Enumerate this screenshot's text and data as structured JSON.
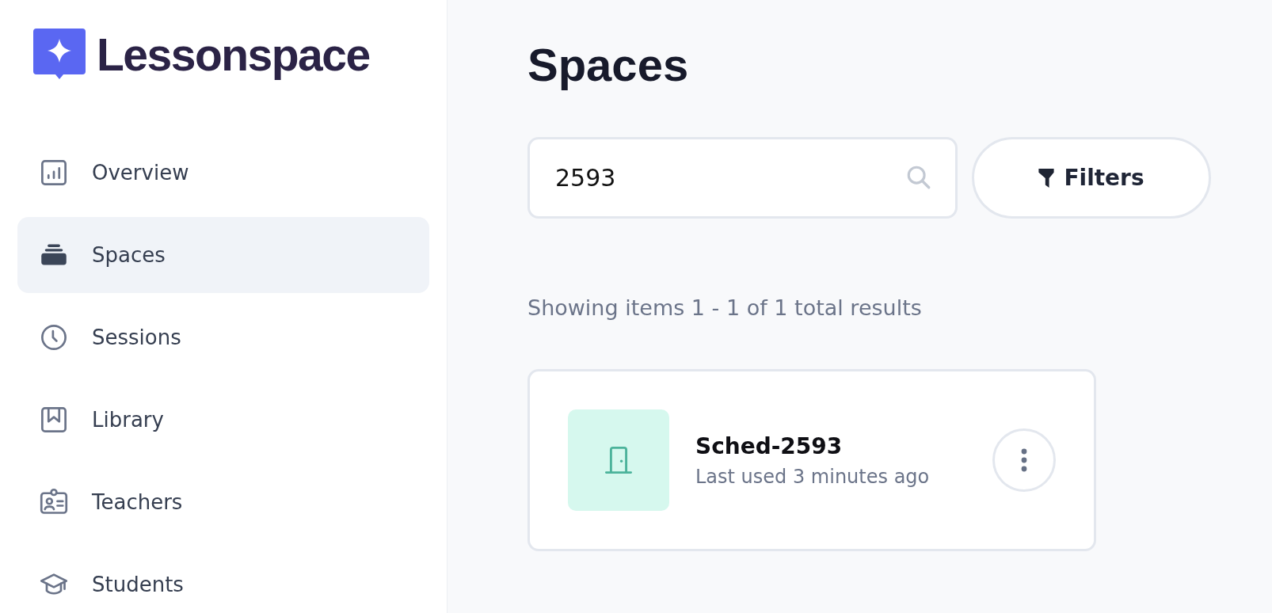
{
  "logo": {
    "text": "Lessonspace"
  },
  "sidebar": {
    "items": [
      {
        "label": "Overview",
        "selected": false
      },
      {
        "label": "Spaces",
        "selected": true
      },
      {
        "label": "Sessions",
        "selected": false
      },
      {
        "label": "Library",
        "selected": false
      },
      {
        "label": "Teachers",
        "selected": false
      },
      {
        "label": "Students",
        "selected": false
      }
    ]
  },
  "page_title": "Spaces",
  "search": {
    "value": "2593"
  },
  "filters_button": "Filters",
  "results_summary": "Showing items 1 - 1 of 1 total results",
  "spaces": [
    {
      "name": "Sched-2593",
      "last_used": "Last used 3 minutes ago"
    }
  ]
}
